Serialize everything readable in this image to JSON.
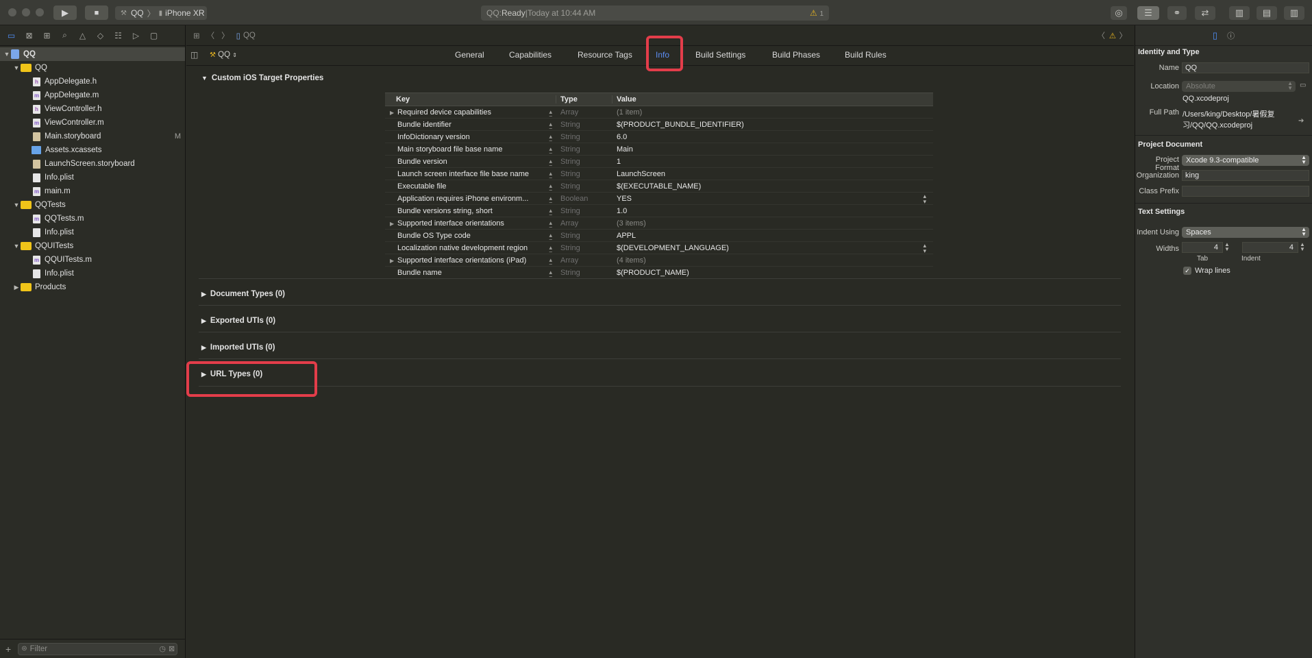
{
  "toolbar": {
    "scheme_name": "QQ",
    "device_name": "iPhone XR",
    "status_prefix": "QQ: ",
    "status_state": "Ready",
    "status_sep": " | ",
    "status_time": "Today at 10:44 AM",
    "warning_count": "1"
  },
  "navigator": {
    "project": "QQ",
    "filter_placeholder": "Filter",
    "items": [
      {
        "label": "QQ"
      },
      {
        "label": "AppDelegate.h"
      },
      {
        "label": "AppDelegate.m"
      },
      {
        "label": "ViewController.h"
      },
      {
        "label": "ViewController.m"
      },
      {
        "label": "Main.storyboard",
        "badge": "M"
      },
      {
        "label": "Assets.xcassets"
      },
      {
        "label": "LaunchScreen.storyboard"
      },
      {
        "label": "Info.plist"
      },
      {
        "label": "main.m"
      },
      {
        "label": "QQTests"
      },
      {
        "label": "QQTests.m"
      },
      {
        "label": "Info.plist"
      },
      {
        "label": "QQUITests"
      },
      {
        "label": "QQUITests.m"
      },
      {
        "label": "Info.plist"
      },
      {
        "label": "Products"
      }
    ]
  },
  "editor": {
    "breadcrumb": "QQ",
    "target": "QQ",
    "tabs": [
      "General",
      "Capabilities",
      "Resource Tags",
      "Info",
      "Build Settings",
      "Build Phases",
      "Build Rules"
    ],
    "active_tab": "Info",
    "custom_props_title": "Custom iOS Target Properties",
    "table_headers": {
      "key": "Key",
      "type": "Type",
      "value": "Value"
    },
    "rows": [
      {
        "key": "Required device capabilities",
        "type": "Array",
        "value": "(1 item)"
      },
      {
        "key": "Bundle identifier",
        "type": "String",
        "value": "$(PRODUCT_BUNDLE_IDENTIFIER)"
      },
      {
        "key": "InfoDictionary version",
        "type": "String",
        "value": "6.0"
      },
      {
        "key": "Main storyboard file base name",
        "type": "String",
        "value": "Main"
      },
      {
        "key": "Bundle version",
        "type": "String",
        "value": "1"
      },
      {
        "key": "Launch screen interface file base name",
        "type": "String",
        "value": "LaunchScreen"
      },
      {
        "key": "Executable file",
        "type": "String",
        "value": "$(EXECUTABLE_NAME)"
      },
      {
        "key": "Application requires iPhone environm...",
        "type": "Boolean",
        "value": "YES"
      },
      {
        "key": "Bundle versions string, short",
        "type": "String",
        "value": "1.0"
      },
      {
        "key": "Supported interface orientations",
        "type": "Array",
        "value": "(3 items)"
      },
      {
        "key": "Bundle OS Type code",
        "type": "String",
        "value": "APPL"
      },
      {
        "key": "Localization native development region",
        "type": "String",
        "value": "$(DEVELOPMENT_LANGUAGE)"
      },
      {
        "key": "Supported interface orientations (iPad)",
        "type": "Array",
        "value": "(4 items)"
      },
      {
        "key": "Bundle name",
        "type": "String",
        "value": "$(PRODUCT_NAME)"
      }
    ],
    "sections": [
      "Document Types (0)",
      "Exported UTIs (0)",
      "Imported UTIs (0)",
      "URL Types (0)"
    ]
  },
  "inspector": {
    "identity_title": "Identity and Type",
    "name_label": "Name",
    "name_value": "QQ",
    "location_label": "Location",
    "location_value": "Absolute",
    "file_name": "QQ.xcodeproj",
    "full_path_label": "Full Path",
    "full_path_line1": "/Users/king/Desktop/暑假复",
    "full_path_line2": "习/QQ/QQ.xcodeproj",
    "project_doc_title": "Project Document",
    "format_label": "Project Format",
    "format_value": "Xcode 9.3-compatible",
    "org_label": "Organization",
    "org_value": "king",
    "prefix_label": "Class Prefix",
    "prefix_value": "",
    "text_settings_title": "Text Settings",
    "indent_using_label": "Indent Using",
    "indent_using_value": "Spaces",
    "widths_label": "Widths",
    "tab_width": "4",
    "indent_width": "4",
    "tab_label": "Tab",
    "indent_label": "Indent",
    "wrap_label": "Wrap lines"
  },
  "colors": {
    "accent": "#5d8ef5",
    "highlight_box": "#e33d4a",
    "warning": "#e8b520"
  }
}
